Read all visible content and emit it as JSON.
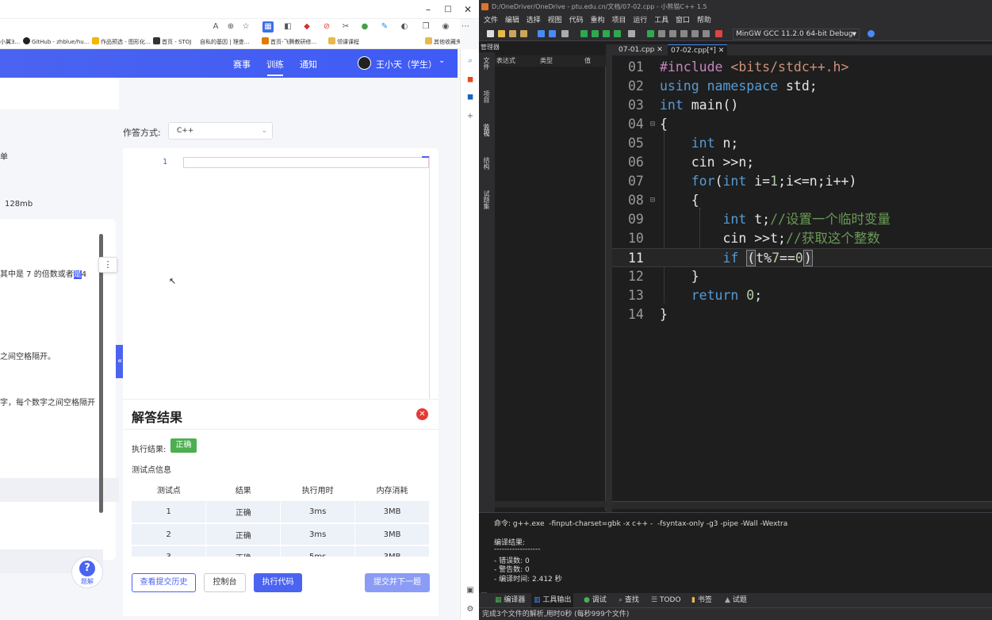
{
  "browser": {
    "toolbar_icons": [
      "read-aloud-icon",
      "zoom-icon",
      "favorite-icon",
      "extension-icon",
      "collection-icon",
      "split-icon",
      "profile-icon",
      "menu-icon"
    ],
    "bookmarks": [
      {
        "label": "小翼3..."
      },
      {
        "label": "GitHub - zhblue/hu..."
      },
      {
        "label": "作品预选 - 图形化..."
      },
      {
        "label": "首页 - STOJ"
      },
      {
        "label": "自私的基因 | 理查..."
      },
      {
        "label": "首页-飞腾教研修..."
      },
      {
        "label": "领课课程"
      },
      {
        "label": "其他收藏夹"
      }
    ],
    "window_buttons": [
      "–",
      "□",
      "✕"
    ]
  },
  "site": {
    "nav": {
      "contest": "赛事",
      "train": "训练",
      "notice": "通知"
    },
    "user_name": "王小天（学生）"
  },
  "problem": {
    "line1": "单",
    "line2": "128mb",
    "line3_prefix": "其中是 7 的倍数或者",
    "line3_selected": "是",
    "line3_suffix": "4",
    "line4": "之间空格隔开。",
    "line5": "字，每个数字之间空格隔开"
  },
  "answer": {
    "mode_label": "作答方式:",
    "mode_value": "C++",
    "line_number": "1"
  },
  "result": {
    "title": "解答结果",
    "exec_label": "执行结果:",
    "exec_status": "正确",
    "test_info": "测试点信息",
    "columns": [
      "测试点",
      "结果",
      "执行用时",
      "内存消耗"
    ],
    "rows": [
      [
        "1",
        "正确",
        "3ms",
        "3MB"
      ],
      [
        "2",
        "正确",
        "3ms",
        "3MB"
      ],
      [
        "3",
        "正确",
        "5ms",
        "3MB"
      ]
    ],
    "btn_history": "查看提交历史",
    "btn_console": "控制台",
    "btn_run": "执行代码",
    "btn_submit": "提交并下一题"
  },
  "help": {
    "label": "题解"
  },
  "ide": {
    "title": "D:/OneDriver/OneDrive - ptu.edu.cn/文档/07-02.cpp - 小熊猫C++ 1.5",
    "menu": [
      "文件",
      "编辑",
      "选择",
      "视图",
      "代码",
      "重构",
      "项目",
      "运行",
      "工具",
      "窗口",
      "帮助"
    ],
    "compiler": "MinGW GCC 11.2.0 64-bit Debug",
    "manager": "管理器",
    "left_tabs": [
      "文件",
      "项目",
      "监视",
      "结构",
      "试题集"
    ],
    "watch_columns": [
      "表达式",
      "类型",
      "值"
    ],
    "tabs": [
      {
        "label": "07-01.cpp ✕"
      },
      {
        "label": "07-02.cpp[*] ✕"
      }
    ],
    "code_lines": [
      "01",
      "02",
      "03",
      "04",
      "05",
      "06",
      "07",
      "08",
      "09",
      "10",
      "11",
      "12",
      "13",
      "14"
    ],
    "output": {
      "command": "命令: g++.exe  -finput-charset=gbk -x c++ -  -fsyntax-only -g3 -pipe -Wall -Wextra",
      "result_label": "编译结果:",
      "separator": "------------------",
      "errors": "- 错误数: 0",
      "warnings": "- 警告数: 0",
      "time": "- 编译时间: 2.412 秒",
      "side_tab": "消息"
    },
    "bottom_tabs": [
      "编译器",
      "工具输出",
      "调试",
      "查找",
      "TODO",
      "书签",
      "试题"
    ],
    "status": "完成3个文件的解析,用时0秒 (每秒999个文件)"
  }
}
